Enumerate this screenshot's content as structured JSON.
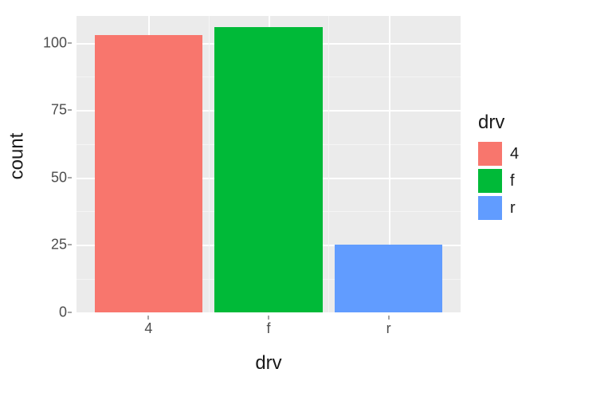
{
  "chart_data": {
    "type": "bar",
    "categories": [
      "4",
      "f",
      "r"
    ],
    "values": [
      103,
      106,
      25
    ],
    "title": "",
    "xlabel": "drv",
    "ylabel": "count",
    "ylim": [
      0,
      110
    ],
    "y_breaks": [
      0,
      25,
      50,
      75,
      100
    ],
    "y_minor": [
      12.5,
      37.5,
      62.5,
      87.5
    ],
    "colors": {
      "4": "#F8766D",
      "f": "#00BA38",
      "r": "#619CFF"
    },
    "legend": {
      "title": "drv",
      "items": [
        {
          "key": "4",
          "label": "4",
          "color": "#F8766D"
        },
        {
          "key": "f",
          "label": "f",
          "color": "#00BA38"
        },
        {
          "key": "r",
          "label": "r",
          "color": "#619CFF"
        }
      ]
    }
  }
}
